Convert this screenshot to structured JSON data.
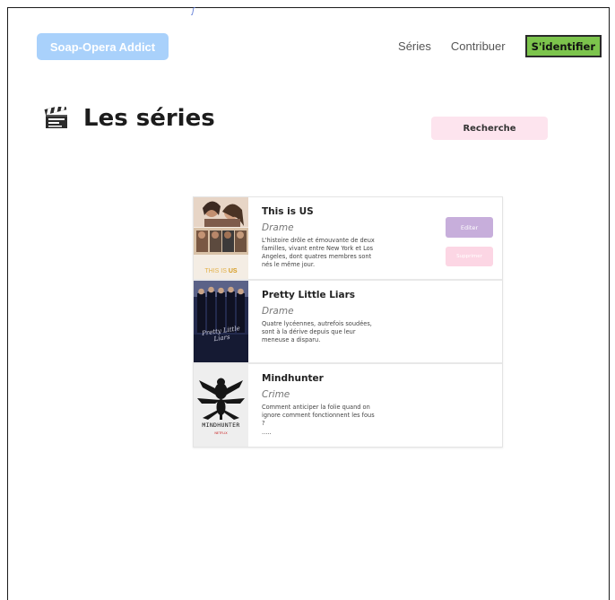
{
  "header": {
    "logo_label": "Soap-Opera Addict",
    "nav": {
      "series": "Séries",
      "contribute": "Contribuer",
      "login": "S'identifier"
    }
  },
  "page": {
    "title": "Les séries",
    "search_label": "Recherche"
  },
  "series": [
    {
      "title": "This is US",
      "genre": "Drame",
      "description": "L'histoire drôle et émouvante de deux familles, vivant entre New York et Los Angeles, dont quatres membres sont nés le même jour.",
      "poster_text_a": "THIS IS ",
      "poster_text_b": "US",
      "edit_label": "Editer",
      "delete_label": "Supprimer"
    },
    {
      "title": "Pretty Little Liars",
      "genre": "Drame",
      "description": "Quatre lycéennes, autrefois soudées, sont à la dérive depuis que leur meneuse a disparu.",
      "poster_text": "Pretty Little Liars"
    },
    {
      "title": "Mindhunter",
      "genre": "Crime",
      "description": "Comment anticiper la folie quand on ignore comment fonctionnent les fous ?",
      "poster_text": "MINDHUNTER",
      "poster_brand": "NETFLIX",
      "ellipsis": "....."
    }
  ],
  "colors": {
    "logo": "#a9d1fb",
    "login": "#7cc44c",
    "search": "#fde4ee",
    "edit": "#c7aedb",
    "delete": "#fcd6e4"
  }
}
